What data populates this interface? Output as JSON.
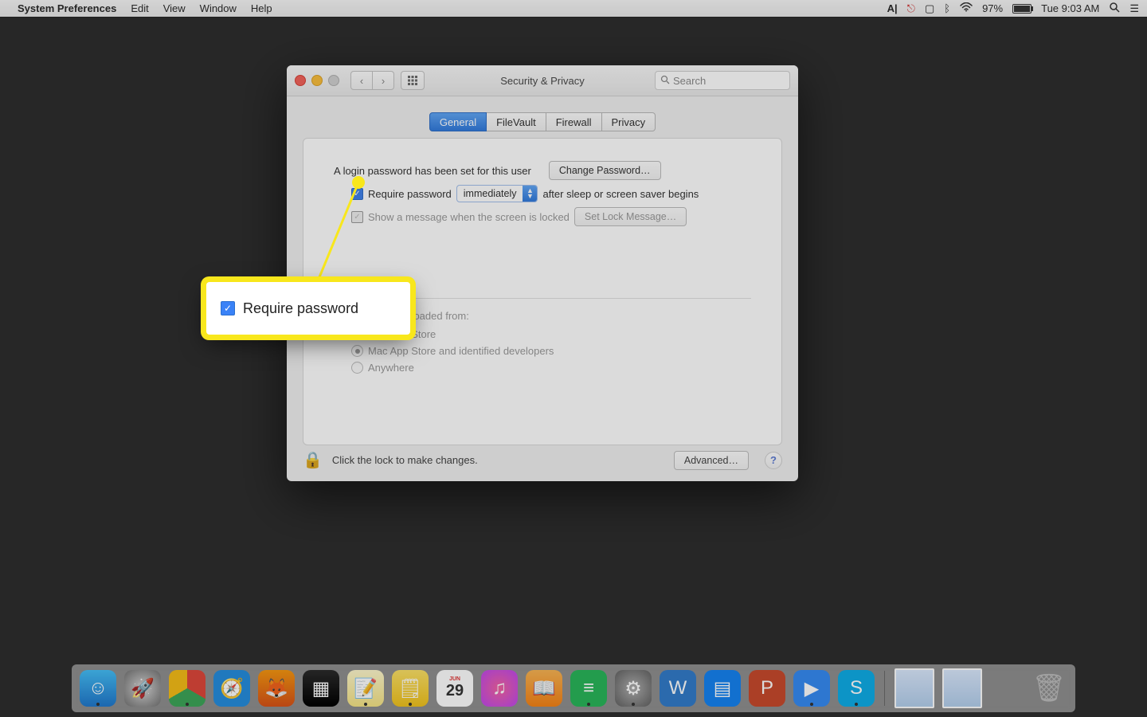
{
  "menubar": {
    "app": "System Preferences",
    "items": [
      "Edit",
      "View",
      "Window",
      "Help"
    ],
    "right": {
      "adobe": "A|",
      "battery_pct": "97%",
      "clock": "Tue 9:03 AM"
    }
  },
  "window": {
    "title": "Security & Privacy",
    "search_placeholder": "Search",
    "tabs": [
      "General",
      "FileVault",
      "Firewall",
      "Privacy"
    ],
    "active_tab": "General",
    "login_line": "A login password has been set for this user",
    "change_pwd": "Change Password…",
    "require_pwd_label": "Require password",
    "require_pwd_dropdown": "immediately",
    "require_pwd_suffix": "after sleep or screen saver begins",
    "show_msg_label": "Show a message when the screen is locked",
    "set_lock_msg": "Set Lock Message…",
    "allow_header": "Allow apps downloaded from:",
    "allow_opts": [
      "Mac App Store",
      "Mac App Store and identified developers",
      "Anywhere"
    ],
    "lock_hint": "Click the lock to make changes.",
    "advanced": "Advanced…"
  },
  "callout": {
    "label": "Require password"
  },
  "dock": {
    "apps": [
      {
        "name": "finder-icon",
        "bg": "linear-gradient(#39c0ff,#1879d6)",
        "glyph": "☺",
        "running": true
      },
      {
        "name": "launchpad-icon",
        "bg": "radial-gradient(circle at 50% 50%,#d9d9d9,#707070)",
        "glyph": "🚀",
        "running": false
      },
      {
        "name": "chrome-icon",
        "bg": "conic-gradient(#ea4335 0 120deg,#34a853 120deg 240deg,#fbbc05 240deg 360deg)",
        "glyph": "",
        "running": true
      },
      {
        "name": "safari-icon",
        "bg": "radial-gradient(circle,#fff 0 20%,#1b8fe8 20% 100%)",
        "glyph": "🧭",
        "running": false
      },
      {
        "name": "firefox-icon",
        "bg": "linear-gradient(#ff9500,#e34f0e)",
        "glyph": "🦊",
        "running": false
      },
      {
        "name": "mission-control-icon",
        "bg": "linear-gradient(#2b2b2b,#000)",
        "glyph": "▦",
        "running": false
      },
      {
        "name": "notes-icon",
        "bg": "linear-gradient(#fff8c8,#f8e47a)",
        "glyph": "📝",
        "running": true
      },
      {
        "name": "stickies-icon",
        "bg": "linear-gradient(#ffe159,#f5c20a)",
        "glyph": "🗒",
        "running": true
      },
      {
        "name": "calendar-icon",
        "bg": "#fff",
        "glyph": "29",
        "running": false
      },
      {
        "name": "itunes-icon",
        "bg": "radial-gradient(circle,#ff5ea3,#c643ff)",
        "glyph": "♫",
        "running": false
      },
      {
        "name": "ibooks-icon",
        "bg": "linear-gradient(#ffb347,#ff8008)",
        "glyph": "📖",
        "running": false
      },
      {
        "name": "spotify-icon",
        "bg": "#1db954",
        "glyph": "≡",
        "running": true
      },
      {
        "name": "system-preferences-icon",
        "bg": "radial-gradient(circle,#b0b0b0,#606060)",
        "glyph": "⚙",
        "running": true
      },
      {
        "name": "word-icon",
        "bg": "#2b7cd3",
        "glyph": "W",
        "running": false
      },
      {
        "name": "keynote-icon",
        "bg": "#0a84ff",
        "glyph": "▤",
        "running": false
      },
      {
        "name": "powerpoint-icon",
        "bg": "#d24726",
        "glyph": "P",
        "running": false
      },
      {
        "name": "zoom-icon",
        "bg": "#2d8cff",
        "glyph": "▶",
        "running": true
      },
      {
        "name": "skype-icon",
        "bg": "#00aff0",
        "glyph": "S",
        "running": true
      }
    ]
  }
}
